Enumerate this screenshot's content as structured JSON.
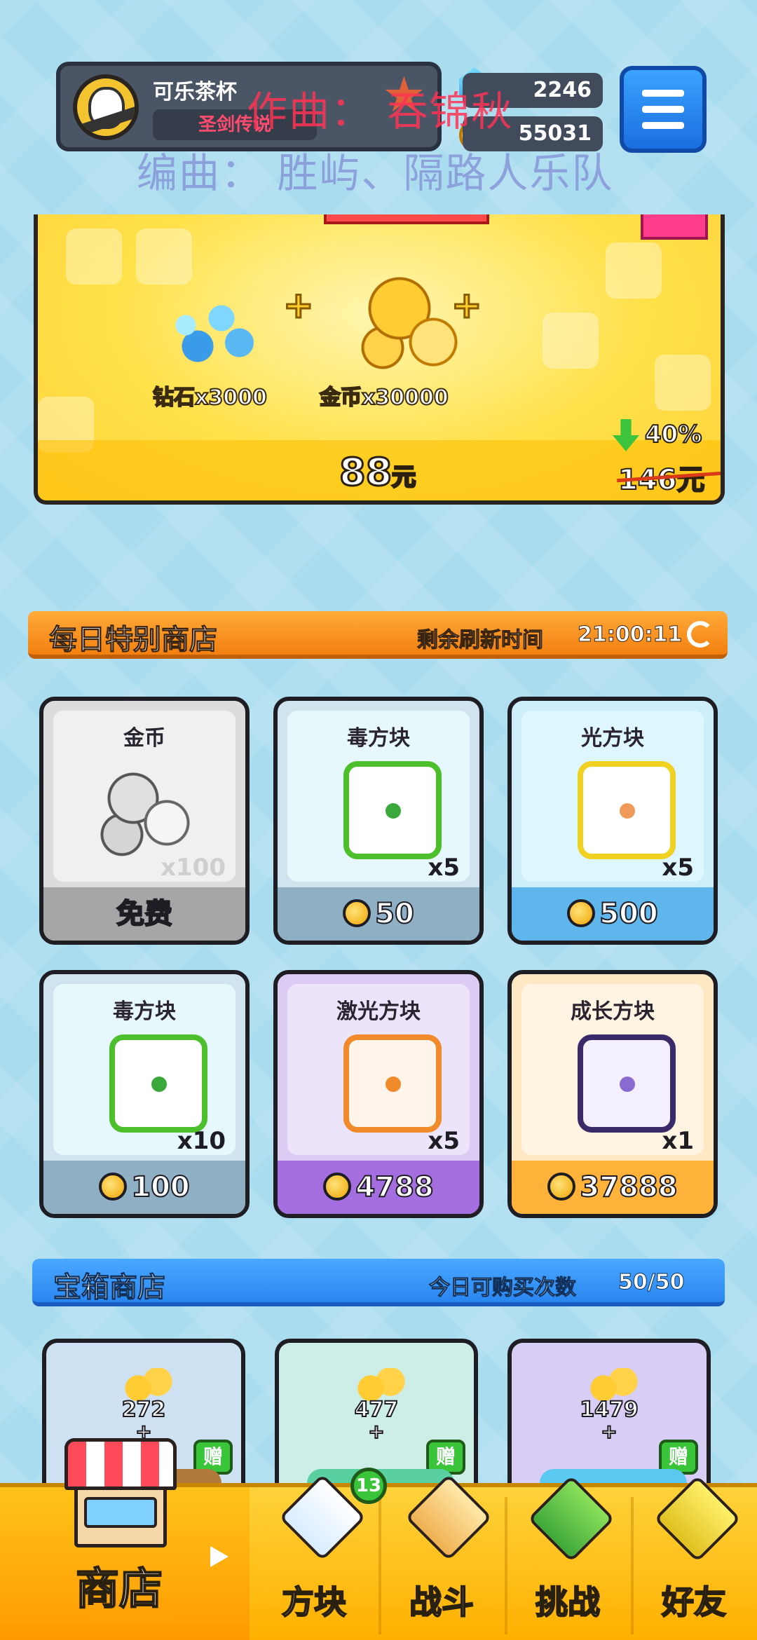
{
  "hud": {
    "player_name": "可乐茶杯",
    "player_title": "圣剑传说",
    "diamonds": "2246",
    "coins": "55031",
    "lyric_line1": "作曲： 吞锦秋",
    "lyric_line2": "编曲： 胜屿、隔路人乐队"
  },
  "offer": {
    "diamond_label": "钻石x3000",
    "plus": "+",
    "coin_label": "金币x30000",
    "price": "88",
    "price_unit": "元",
    "discount": "40%",
    "old_price": "146元"
  },
  "daily_shop": {
    "title": "每日特别商店",
    "refresh_label": "剩余刷新时间",
    "refresh_time": "21:00:11",
    "items": [
      {
        "name": "金币",
        "qty": "x100",
        "price": "免费",
        "theme": "#a6a6a6"
      },
      {
        "name": "毒方块",
        "qty": "x5",
        "price": "50",
        "theme": "#8fb0c4"
      },
      {
        "name": "光方块",
        "qty": "x5",
        "price": "500",
        "theme": "#5fb6ec"
      },
      {
        "name": "毒方块",
        "qty": "x10",
        "price": "100",
        "theme": "#8fb0c4"
      },
      {
        "name": "激光方块",
        "qty": "x5",
        "price": "4788",
        "theme": "#a46de0"
      },
      {
        "name": "成长方块",
        "qty": "x1",
        "price": "37888",
        "theme": "#ffb23a"
      }
    ]
  },
  "chest_shop": {
    "title": "宝箱商店",
    "purchase_label": "今日可购买次数",
    "purchase_count": "50/50",
    "chests": [
      {
        "amount": "272",
        "plus": "+",
        "gift": "赠"
      },
      {
        "amount": "477",
        "plus": "+",
        "gift": "赠"
      },
      {
        "amount": "1479",
        "plus": "+",
        "gift": "赠"
      }
    ]
  },
  "nav": {
    "items": [
      {
        "label": "商店",
        "icon": "shop-icon"
      },
      {
        "label": "方块",
        "icon": "block-icon"
      },
      {
        "label": "战斗",
        "icon": "battle-icon"
      },
      {
        "label": "挑战",
        "icon": "challenge-icon"
      },
      {
        "label": "好友",
        "icon": "friends-icon"
      }
    ],
    "block_badge": "13"
  }
}
